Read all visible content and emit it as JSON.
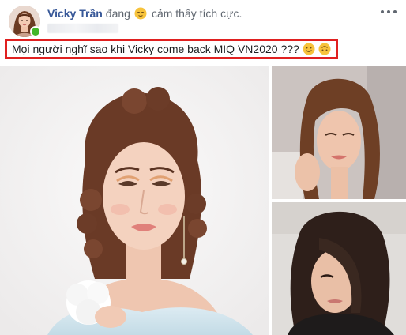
{
  "post": {
    "author_name": "Vicky Trần",
    "feeling_prefix": "đang",
    "feeling_emoji": "relieved-face-emoji",
    "feeling_text": "cảm thấy tích cực.",
    "text": "Mọi người nghĩ sao khi Vicky come back MIQ VN2020 ???",
    "text_emojis": [
      "smiling-face-emoji",
      "upside-down-face-emoji"
    ],
    "status": "online"
  },
  "photos": [
    {
      "name": "photo-main",
      "subject": "portrait-curly-updo"
    },
    {
      "name": "photo-top-right",
      "subject": "portrait-wavy-hair"
    },
    {
      "name": "photo-bottom-right",
      "subject": "portrait-dark-hair"
    }
  ],
  "colors": {
    "author": "#385898",
    "meta_text": "#606770",
    "highlight_border": "#e02020",
    "online": "#42b72a",
    "emoji_yellow": "#f7c33c"
  }
}
